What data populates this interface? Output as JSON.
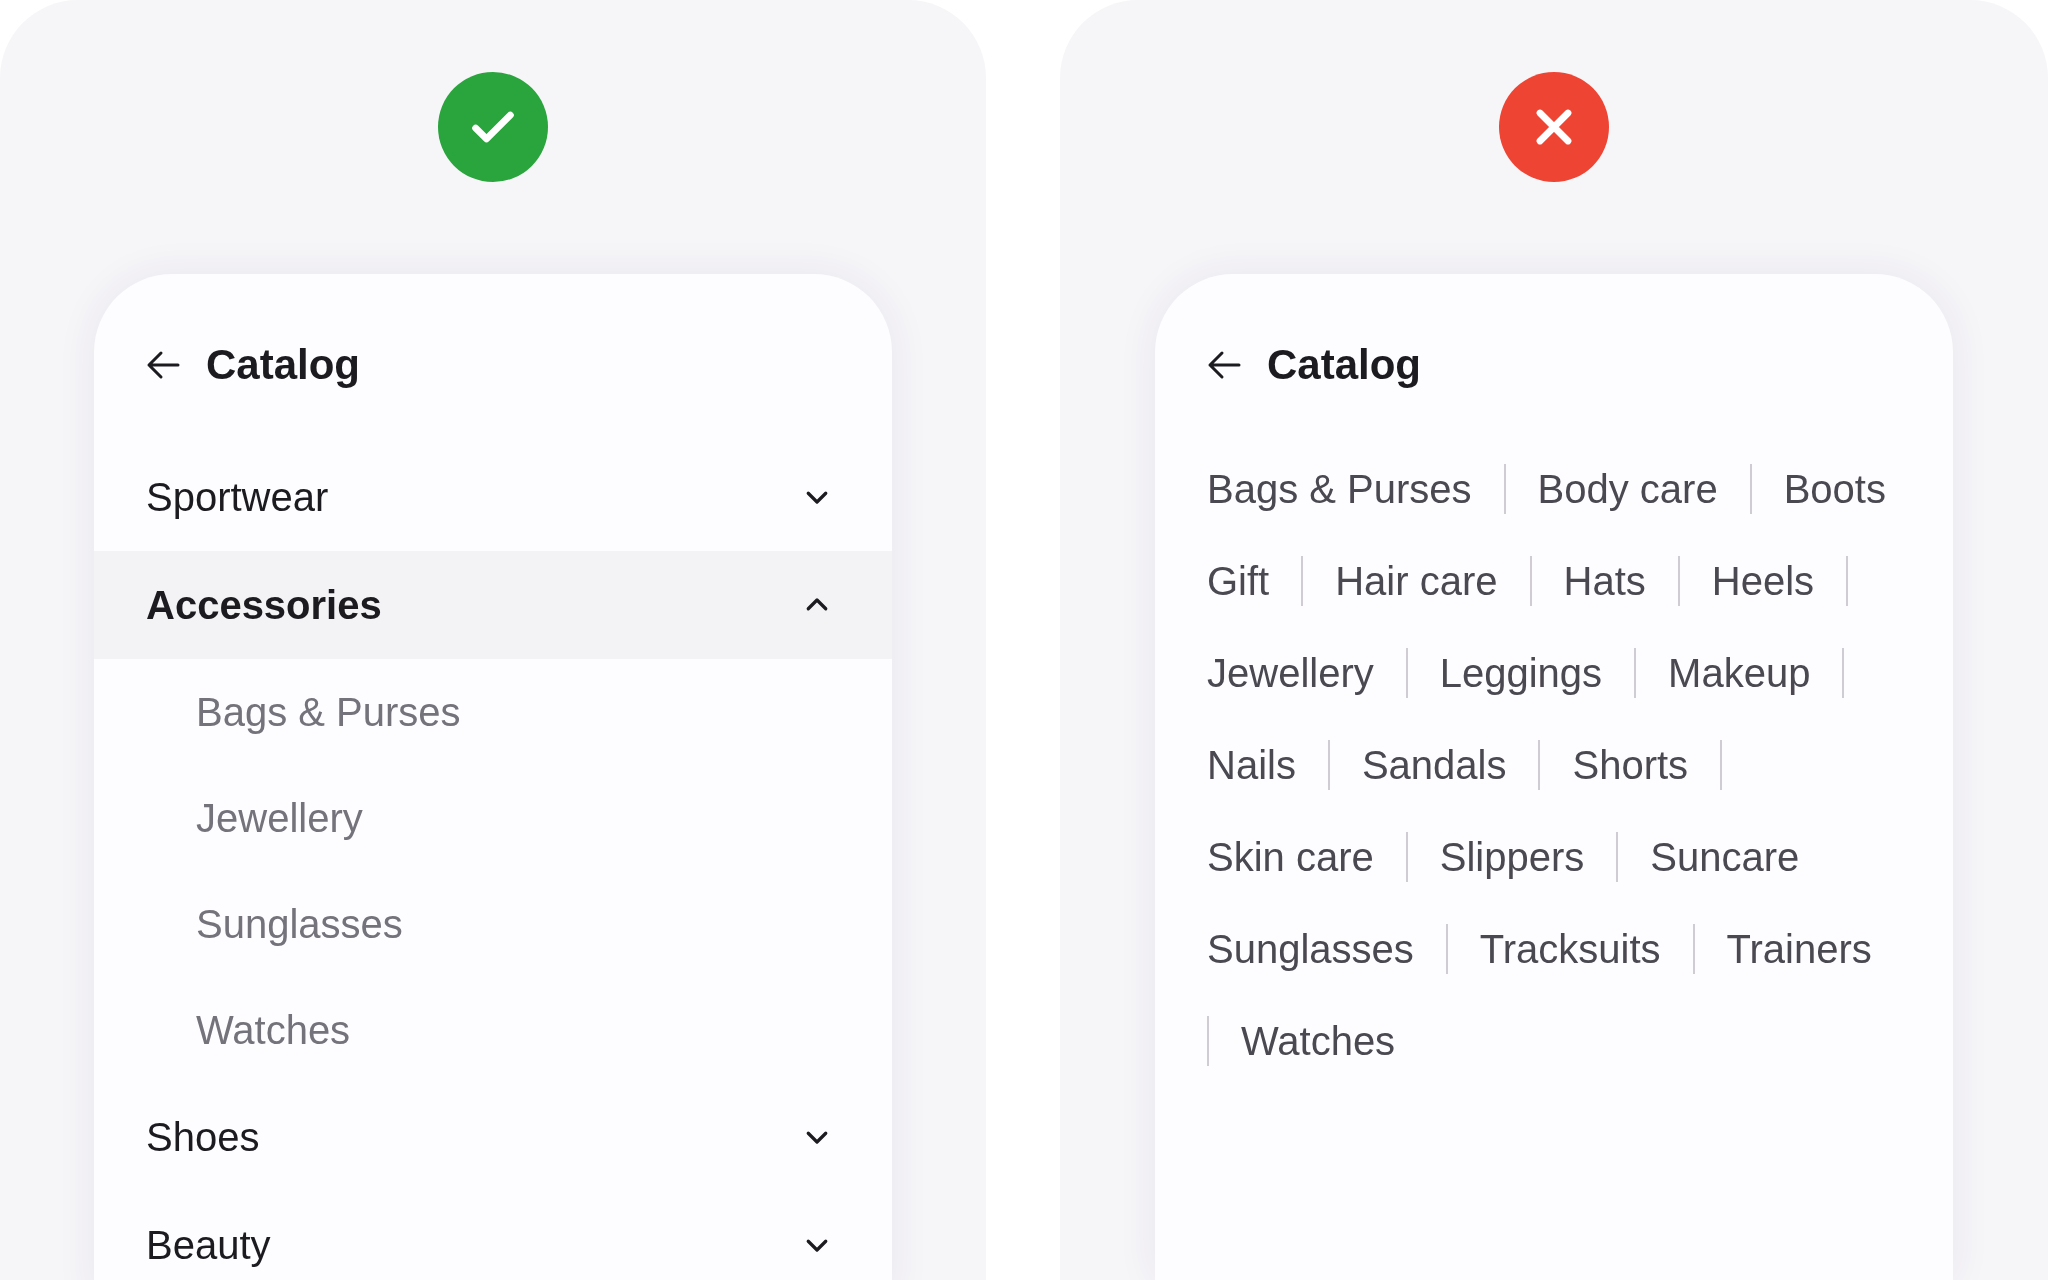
{
  "examples": [
    {
      "approved": true,
      "title": "Catalog",
      "kind": "accordion",
      "categories": [
        {
          "label": "Sportwear",
          "expanded": false
        },
        {
          "label": "Accessories",
          "expanded": true,
          "children": [
            {
              "label": "Bags & Purses"
            },
            {
              "label": "Jewellery"
            },
            {
              "label": "Sunglasses"
            },
            {
              "label": "Watches"
            }
          ]
        },
        {
          "label": "Shoes",
          "expanded": false
        },
        {
          "label": "Beauty",
          "expanded": false
        }
      ]
    },
    {
      "approved": false,
      "title": "Catalog",
      "kind": "tag-list",
      "rows": [
        {
          "leading_divider": false,
          "tags": [
            {
              "label": "Bags & Purses",
              "divider_after": true
            },
            {
              "label": "Body care",
              "divider_after": true
            },
            {
              "label": "Boots",
              "divider_after": false
            }
          ]
        },
        {
          "leading_divider": false,
          "tags": [
            {
              "label": "Gift",
              "divider_after": true
            },
            {
              "label": "Hair care",
              "divider_after": true
            },
            {
              "label": "Hats",
              "divider_after": true
            },
            {
              "label": "Heels",
              "divider_after": true
            }
          ]
        },
        {
          "leading_divider": false,
          "tags": [
            {
              "label": "Jewellery",
              "divider_after": true
            },
            {
              "label": "Leggings",
              "divider_after": true
            },
            {
              "label": "Makeup",
              "divider_after": true
            }
          ]
        },
        {
          "leading_divider": false,
          "tags": [
            {
              "label": "Nails",
              "divider_after": true
            },
            {
              "label": "Sandals",
              "divider_after": true
            },
            {
              "label": "Shorts",
              "divider_after": true
            }
          ]
        },
        {
          "leading_divider": false,
          "tags": [
            {
              "label": "Skin care",
              "divider_after": true
            },
            {
              "label": "Slippers",
              "divider_after": true
            },
            {
              "label": "Suncare",
              "divider_after": false
            }
          ]
        },
        {
          "leading_divider": false,
          "tags": [
            {
              "label": "Sunglasses",
              "divider_after": true
            },
            {
              "label": "Tracksuits",
              "divider_after": true
            },
            {
              "label": "Trainers",
              "divider_after": false
            }
          ]
        },
        {
          "leading_divider": true,
          "tags": [
            {
              "label": "Watches",
              "divider_after": false
            }
          ]
        }
      ]
    }
  ]
}
